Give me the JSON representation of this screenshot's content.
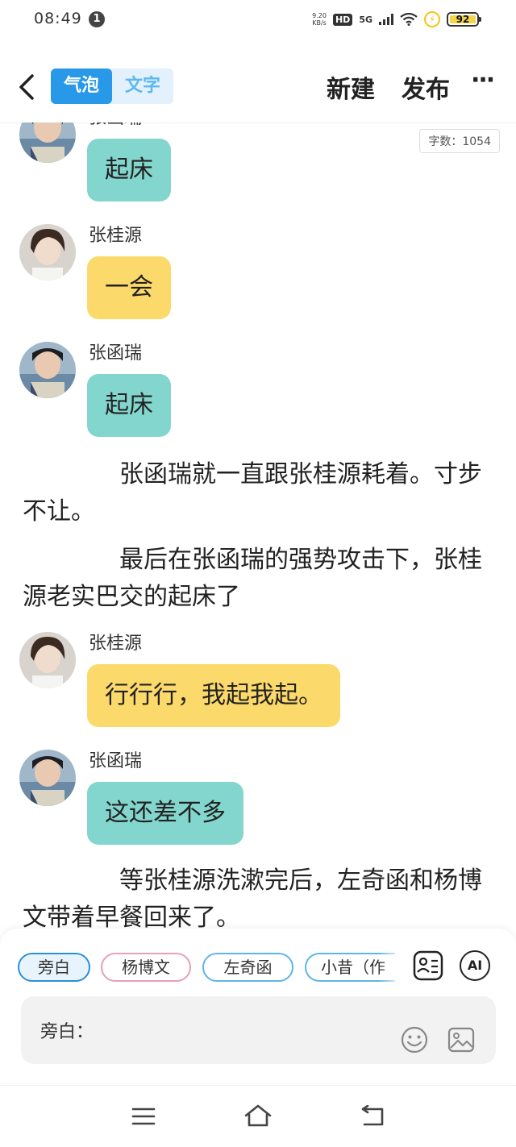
{
  "status_bar": {
    "time": "08:49",
    "notification_count": "1",
    "net_speed_value": "9.20",
    "net_speed_unit": "KB/s",
    "hd": "HD",
    "network": "5G",
    "battery": "92"
  },
  "header": {
    "mode_bubble": "气泡",
    "mode_text": "文字",
    "new_label": "新建",
    "publish_label": "发布",
    "more_label": "···"
  },
  "word_count": "字数：1054",
  "messages": [
    {
      "type": "chat",
      "speaker": "张函瑞",
      "text": "起床",
      "color": "#83d6cd"
    },
    {
      "type": "chat",
      "speaker": "张桂源",
      "text": "一会",
      "color": "#fbd96a"
    },
    {
      "type": "chat",
      "speaker": "张函瑞",
      "text": "起床",
      "color": "#83d6cd"
    },
    {
      "type": "narration",
      "text": "张函瑞就一直跟张桂源耗着。寸步不让。"
    },
    {
      "type": "narration",
      "text": "最后在张函瑞的强势攻击下，张桂源老实巴交的起床了"
    },
    {
      "type": "chat",
      "speaker": "张桂源",
      "text": "行行行，我起我起。",
      "color": "#fbd96a"
    },
    {
      "type": "chat",
      "speaker": "张函瑞",
      "text": "这还差不多",
      "color": "#83d6cd"
    },
    {
      "type": "narration",
      "text": "等张桂源洗漱完后，左奇函和杨博文带着早餐回来了。"
    }
  ],
  "role_chips": [
    "旁白",
    "杨博文",
    "左奇函",
    "小昔（作"
  ],
  "ai_label": "AI",
  "input": {
    "label": "旁白："
  },
  "icons": {
    "back": "back-arrow-icon",
    "role_card": "role-card-icon",
    "emoji": "emoji-icon",
    "image": "image-icon",
    "nav_menu": "menu-icon",
    "nav_home": "home-icon",
    "nav_back": "back-icon"
  },
  "colors": {
    "accent": "#2898e8",
    "teal_bubble": "#83d6cd",
    "yellow_bubble": "#fbd96a"
  }
}
